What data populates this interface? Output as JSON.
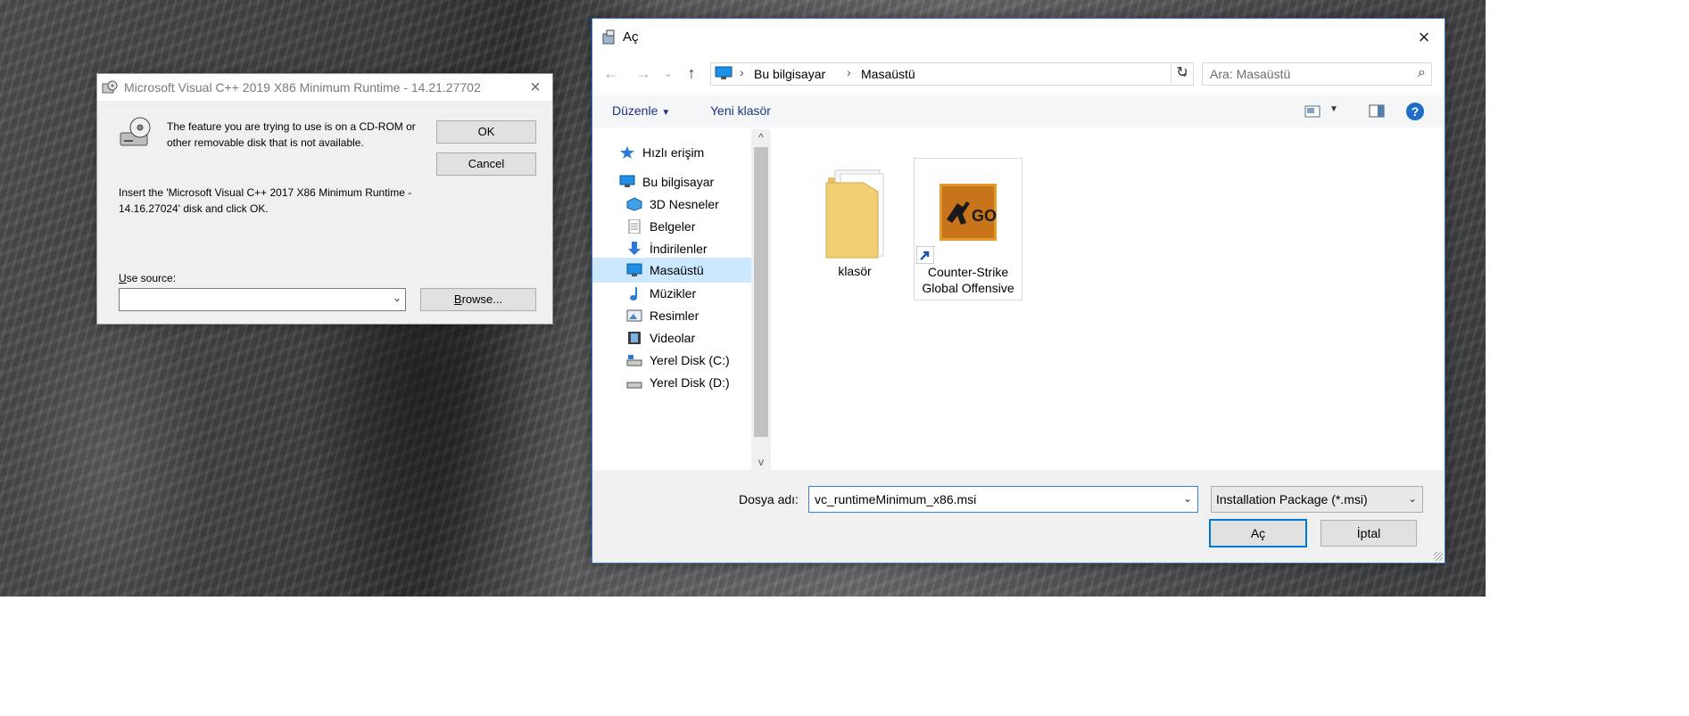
{
  "vc_dialog": {
    "title": "Microsoft Visual C++ 2019 X86 Minimum Runtime - 14.21.27702",
    "message": "The feature you are trying to use is on a CD-ROM or other removable disk that is not available.",
    "insert_message": "Insert the 'Microsoft Visual C++ 2017 X86 Minimum Runtime - 14.16.27024' disk and click OK.",
    "ok_label": "OK",
    "cancel_label": "Cancel",
    "use_source_label": "Use source:",
    "use_source_value": "",
    "browse_label": "Browse...",
    "close_icon": "×"
  },
  "open_dialog": {
    "title": "Aç",
    "close_icon": "×",
    "nav": {
      "back_icon": "←",
      "forward_icon": "→",
      "recent_icon": "⌄",
      "up_icon": "↑"
    },
    "address": {
      "crumbs": [
        "Bu bilgisayar",
        "Masaüstü"
      ],
      "separator": "›"
    },
    "refresh_icon": "↻",
    "search_placeholder": "Ara: Masaüstü",
    "search_icon": "⌕",
    "toolbar": {
      "organize_label": "Düzenle",
      "new_folder_label": "Yeni klasör",
      "help_label": "?"
    },
    "tree": [
      {
        "label": "Hızlı erişim",
        "icon": "star-icon"
      },
      {
        "label": "Bu bilgisayar",
        "icon": "computer-icon"
      },
      {
        "label": "3D Nesneler",
        "icon": "cube-icon"
      },
      {
        "label": "Belgeler",
        "icon": "document-icon"
      },
      {
        "label": "İndirilenler",
        "icon": "download-icon"
      },
      {
        "label": "Masaüstü",
        "icon": "desktop-icon",
        "selected": true
      },
      {
        "label": "Müzikler",
        "icon": "music-icon"
      },
      {
        "label": "Resimler",
        "icon": "pictures-icon"
      },
      {
        "label": "Videolar",
        "icon": "video-icon"
      },
      {
        "label": "Yerel Disk (C:)",
        "icon": "disk-icon"
      },
      {
        "label": "Yerel Disk (D:)",
        "icon": "disk-icon"
      }
    ],
    "files": [
      {
        "label": "klasör",
        "icon": "folder-icon"
      },
      {
        "label": "Counter-Strike Global Offensive",
        "icon": "csgo-shortcut-icon"
      }
    ],
    "filename_label": "Dosya adı:",
    "filename_value": "vc_runtimeMinimum_x86.msi",
    "filetype_value": "Installation Package (*.msi)",
    "open_label": "Aç",
    "cancel_label": "İptal",
    "scroll_up": "^",
    "scroll_down": "v"
  },
  "colors": {
    "accent": "#0078d7",
    "selection": "#cce8ff",
    "link": "#1e3287"
  }
}
